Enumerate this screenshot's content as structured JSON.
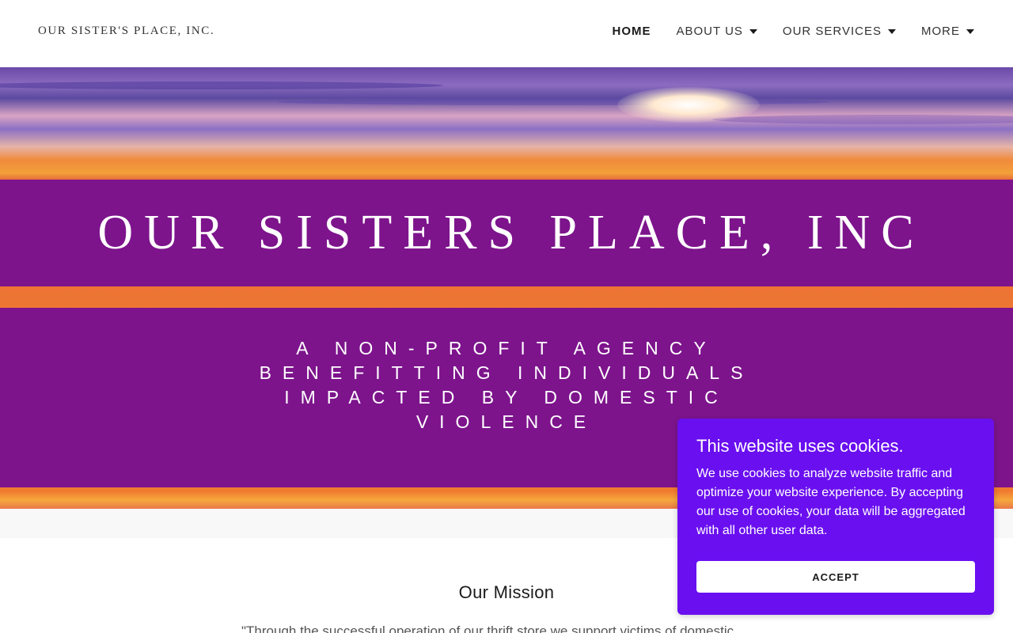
{
  "header": {
    "logo": "OUR SISTER'S PLACE, INC.",
    "nav": [
      {
        "label": "HOME",
        "active": true,
        "dropdown": false
      },
      {
        "label": "ABOUT US",
        "active": false,
        "dropdown": true
      },
      {
        "label": "OUR SERVICES",
        "active": false,
        "dropdown": true
      },
      {
        "label": "MORE",
        "active": false,
        "dropdown": true
      }
    ]
  },
  "hero": {
    "title": "OUR SISTERS PLACE, INC",
    "tagline_lines": [
      "A NON-PROFIT AGENCY",
      "BENEFITTING INDIVIDUALS",
      "IMPACTED BY DOMESTIC",
      "VIOLENCE"
    ],
    "band_color": "#7d148c"
  },
  "mission": {
    "title": "Our Mission",
    "text": "\"Through the successful operation of our thrift store we support victims of domestic"
  },
  "cookie_banner": {
    "title": "This website uses cookies.",
    "body": "We use cookies to analyze website traffic and optimize your website experience. By accepting our use of cookies, your data will be aggregated with all other user data.",
    "button": "ACCEPT",
    "background": "#6a0ff0"
  }
}
